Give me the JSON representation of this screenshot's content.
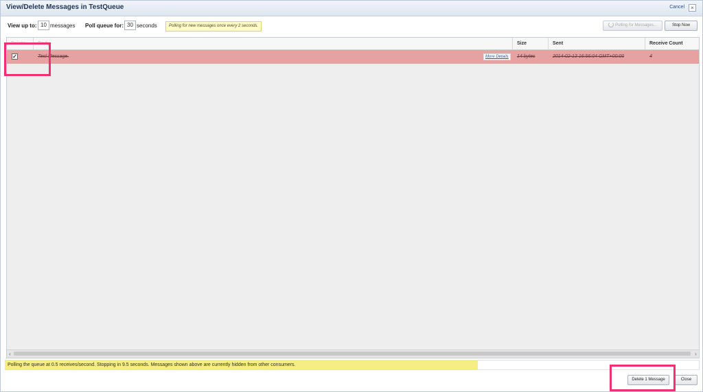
{
  "dialog": {
    "title": "View/Delete Messages in TestQueue",
    "cancel_label": "Cancel",
    "close_glyph": "×"
  },
  "controls": {
    "view_up_to_label": "View up to:",
    "view_up_to_value": "10",
    "messages_label": "messages",
    "poll_queue_label": "Poll queue for:",
    "poll_queue_value": "30",
    "seconds_label": "seconds",
    "polling_note": "Polling for new messages once every 2 seconds.",
    "polling_button_label": "Polling for Messages...",
    "stop_button_label": "Stop Now"
  },
  "table": {
    "columns": [
      "Delete",
      "Body",
      "Size",
      "Sent",
      "Receive Count"
    ],
    "rows": [
      {
        "checked": true,
        "checkmark": "✓",
        "body": "Test Message.",
        "more_details_label": "More Details",
        "size": "14 bytes",
        "sent": "2014-02-13 16:56:04 GMT+00:00",
        "receive_count": "4"
      }
    ],
    "scroll_left_glyph": "‹",
    "scroll_right_glyph": "›"
  },
  "status": {
    "message": "Polling the queue at 0.5 receives/second. Stopping in 9.5 seconds. Messages shown above are currently hidden from other consumers."
  },
  "footer": {
    "delete_button_label": "Delete 1 Message",
    "close_button_label": "Close"
  },
  "colors": {
    "row_deleted": "#e6a1a1",
    "status_highlight": "#f6ee84",
    "annotation_box": "#f0316f"
  }
}
